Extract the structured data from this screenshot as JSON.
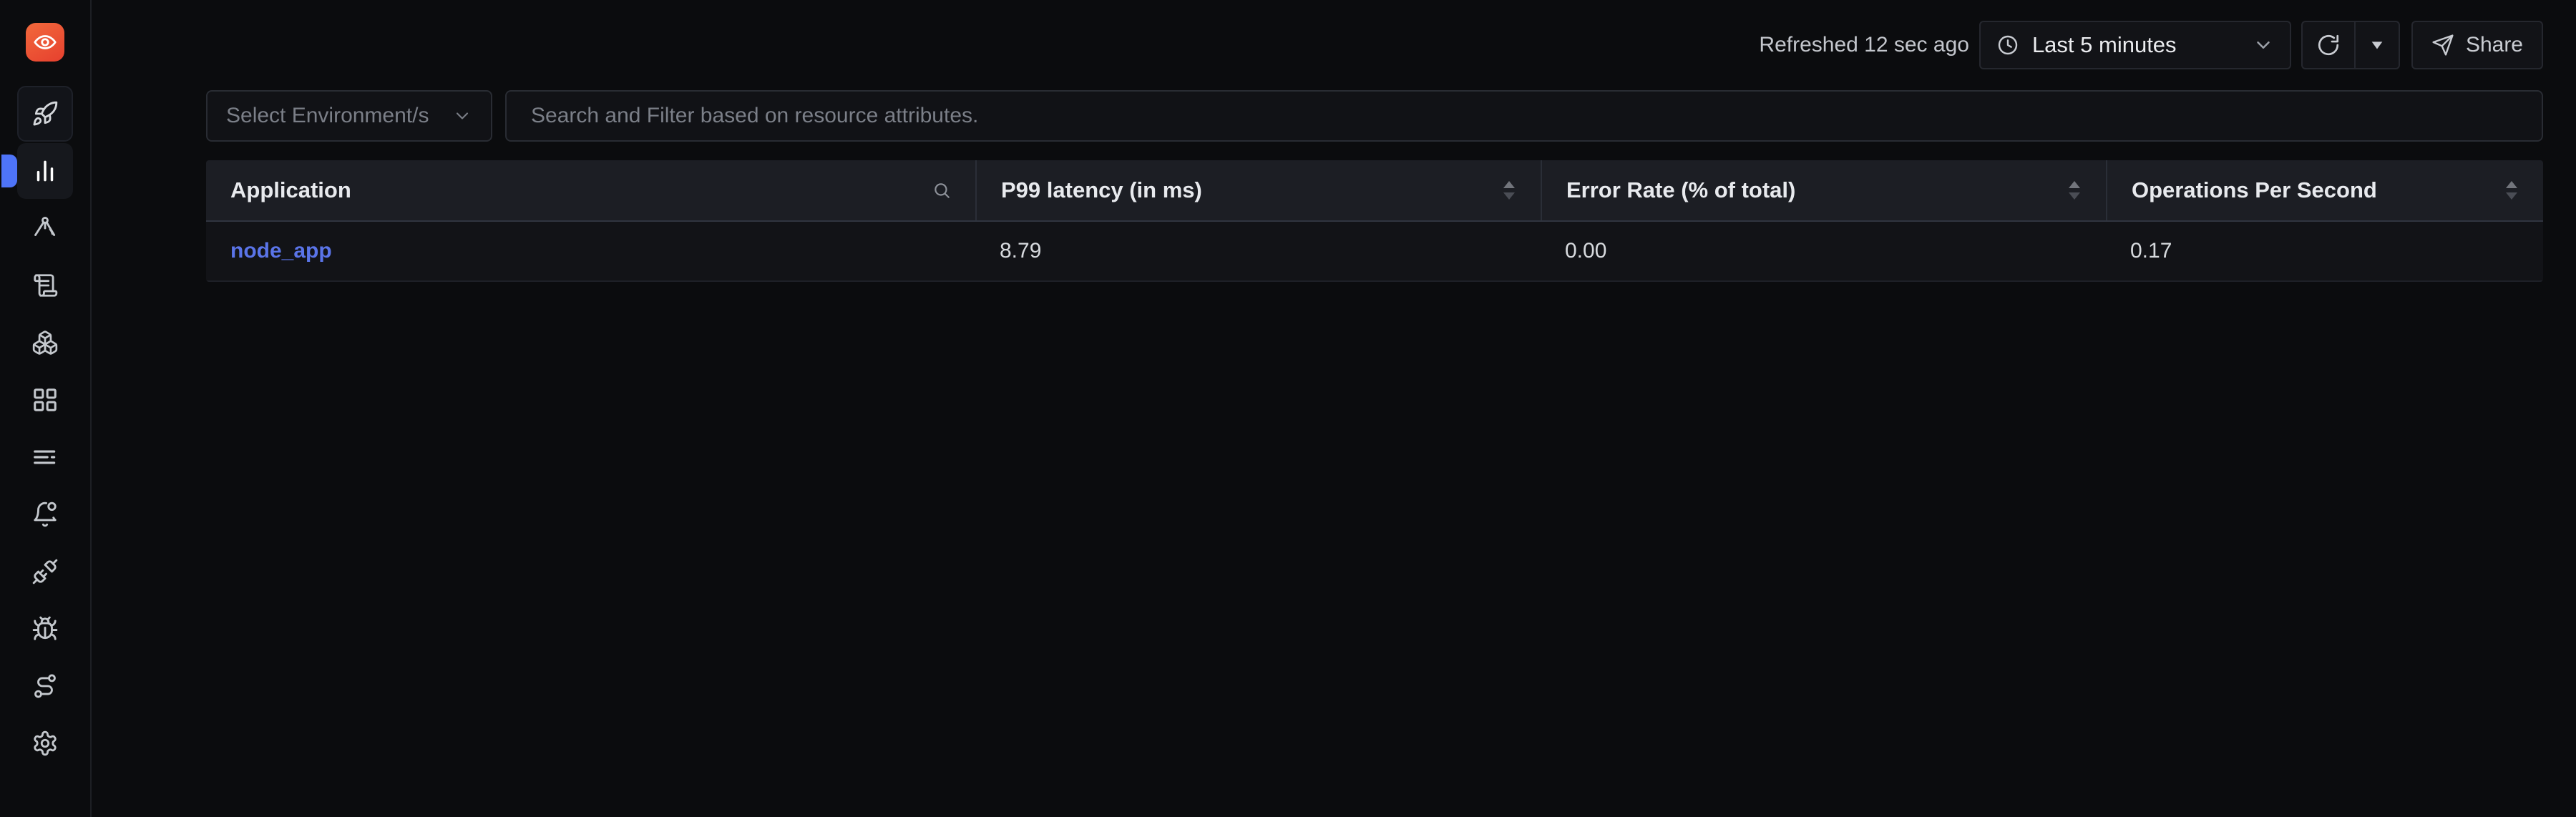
{
  "app": {
    "logo_icon": "eye-logo-icon",
    "brand_color": "#e6402e"
  },
  "sidebar": {
    "items": [
      {
        "icon": "rocket-icon",
        "name": "get-started",
        "state": "boxed"
      },
      {
        "icon": "bar-chart-icon",
        "name": "services",
        "state": "active"
      },
      {
        "icon": "compass-icon",
        "name": "traces",
        "state": "normal"
      },
      {
        "icon": "scroll-icon",
        "name": "logs",
        "state": "normal"
      },
      {
        "icon": "boxes-icon",
        "name": "infrastructure-monitoring",
        "state": "normal"
      },
      {
        "icon": "layout-grid-icon",
        "name": "dashboards",
        "state": "normal"
      },
      {
        "icon": "align-left-icon",
        "name": "messaging-queues",
        "state": "normal"
      },
      {
        "icon": "bell-dot-icon",
        "name": "alerts",
        "state": "normal"
      },
      {
        "icon": "unplug-icon",
        "name": "exceptions",
        "state": "normal"
      },
      {
        "icon": "bug-icon",
        "name": "issues",
        "state": "normal"
      },
      {
        "icon": "route-icon",
        "name": "service-map",
        "state": "normal"
      },
      {
        "icon": "settings-gear-icon",
        "name": "settings",
        "state": "normal"
      }
    ]
  },
  "topbar": {
    "refreshed_text": "Refreshed 12 sec ago",
    "time_range": "Last 5 minutes",
    "clock_icon": "clock-icon",
    "chevron_icon": "chevron-down-icon",
    "refresh_icon": "refresh-cw-icon",
    "refresh_options_icon": "caret-down-icon",
    "share_label": "Share",
    "share_icon": "send-icon"
  },
  "filters": {
    "environment": {
      "placeholder": "Select Environment/s",
      "value": "",
      "chevron_icon": "chevron-down-icon"
    },
    "search": {
      "placeholder": "Search and Filter based on resource attributes.",
      "value": ""
    }
  },
  "table": {
    "columns": [
      {
        "label": "Application",
        "affordance": "search-icon",
        "align": "left"
      },
      {
        "label": "P99 latency (in ms)",
        "affordance": "sort-icon",
        "align": "left"
      },
      {
        "label": "Error Rate (% of total)",
        "affordance": "sort-icon",
        "align": "left"
      },
      {
        "label": "Operations Per Second",
        "affordance": "sort-icon",
        "align": "left"
      }
    ],
    "rows": [
      {
        "application": "node_app",
        "p99_latency_ms": "8.79",
        "error_rate_pct": "0.00",
        "operations_per_second": "0.17"
      }
    ]
  },
  "colors": {
    "accent_blue": "#4e74f8",
    "link_blue": "#5a74e8",
    "page_bg": "#0b0c0e",
    "table_header_bg": "#1c1e24",
    "table_row_bg": "#121317"
  }
}
